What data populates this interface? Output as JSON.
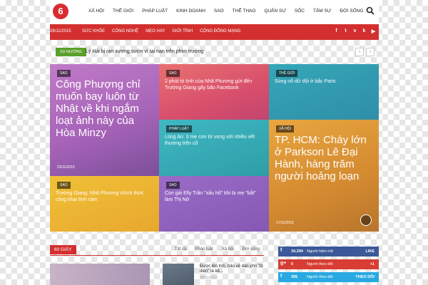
{
  "topnav": {
    "logo": "6",
    "items": [
      "XÃ HỘI",
      "THẾ GIỚI",
      "PHÁP LUẬT",
      "KINH DOANH",
      "SAO",
      "THỂ THAO",
      "QUÂN SỰ",
      "SỐC",
      "TÂM SỰ",
      "ĐỜI SỐNG"
    ]
  },
  "redbar": {
    "date": "26/11/2015",
    "items": [
      "SỨC KHỎE",
      "CÔNG NGHỆ",
      "MẸO HAY",
      "GIỚI TÍNH",
      "CỘNG ĐỒNG MẠNG"
    ]
  },
  "trending": {
    "badge": "XU HƯỚNG",
    "text": "Lý Hải bị rạn xương sườn vì tai nạn trên phim trường"
  },
  "tiles": [
    {
      "cat": "SAO",
      "title": "Công Phượng chỉ muốn bay luôn từ Nhật về khi ngắm loạt ảnh này của Hòa Minzy",
      "date": "23/11/2015"
    },
    {
      "cat": "SAO",
      "title": "2 phút tỏ tình của Nhã Phương gửi đến Trường Giang gây bão Facebook",
      "date": ""
    },
    {
      "cat": "THẾ GIỚI",
      "title": "Súng nổ dữ dội ở bắc Paris",
      "date": ""
    },
    {
      "cat": "PHÁP LUẬT",
      "title": "Long An: 3 mẹ con tử vong với nhiều vết thương trên cổ",
      "date": ""
    },
    {
      "cat": "XÃ HỘI",
      "title": "TP. HCM: Cháy lớn ở Parkson Lê Đại Hành, hàng trăm người hoảng loạn",
      "date": "17/11/2015"
    },
    {
      "cat": "SAO",
      "title": "Trường Giang, Nhã Phương chính thức công khai tình cảm",
      "date": ""
    },
    {
      "cat": "SAO",
      "title": "Con gái Elly Trần \"xấu hổ\" khi bị mẹ \"bắt\" làm Thị Nở",
      "date": ""
    }
  ],
  "section": {
    "title": "60 GIÂY",
    "tabs": [
      "Tất cả",
      "Pháp luật",
      "Xã hội",
      "Đời sống"
    ]
  },
  "news2": {
    "title": "Được lên trời, bảo vệ dân phố \"lộ diện\" là kẻ...",
    "date": "25/11/2015"
  },
  "social": {
    "fb": {
      "icon": "f",
      "count": "34,394",
      "label": "Người hâm mộ",
      "action": "LIKE",
      "color": "#3b5998"
    },
    "gp": {
      "icon": "g+",
      "count": "0",
      "label": "Người theo dõi",
      "action": "+1",
      "color": "#d73d32"
    },
    "tw": {
      "icon": "t",
      "count": "395",
      "label": "Người theo dõi",
      "action": "THEO DÕI",
      "color": "#29a9e1"
    }
  }
}
